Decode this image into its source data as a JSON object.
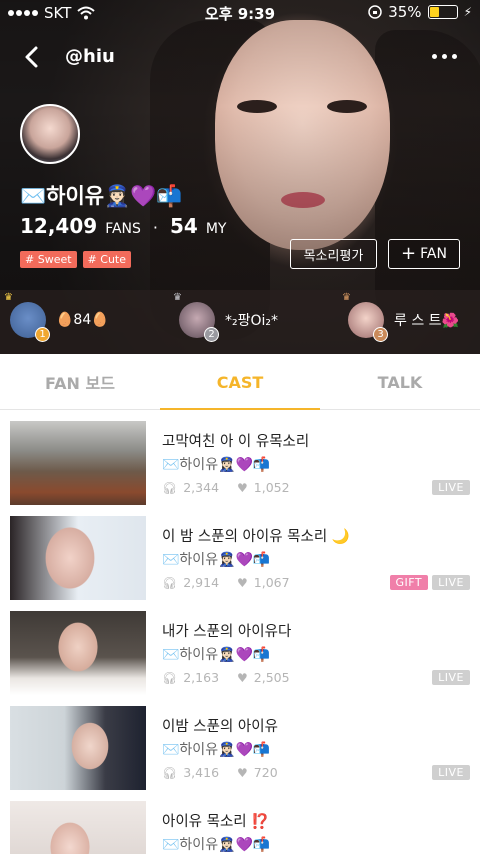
{
  "status_bar": {
    "carrier": "SKT",
    "time": "오후 9:39",
    "battery": "35%"
  },
  "profile": {
    "handle": "@hiu",
    "name": "✉️하이유👮🏻‍♀️💜📬",
    "fans_count": "12,409",
    "fans_label": "FANS",
    "separator": "·",
    "my_count": "54",
    "my_label": "MY",
    "tags": [
      "# Sweet",
      "# Cute"
    ],
    "voice_button": "목소리평가",
    "fan_button": "FAN"
  },
  "ranking": [
    {
      "rank": "1",
      "text": "🥚84🥚",
      "badge_color": "#f0a731"
    },
    {
      "rank": "2",
      "text": "*₂팡Oi₂*",
      "badge_color": "#9a9aa0"
    },
    {
      "rank": "3",
      "text": "루 스 트🌺",
      "badge_color": "#c98a5a"
    }
  ],
  "tabs": [
    {
      "label": "FAN 보드",
      "active": false
    },
    {
      "label": "CAST",
      "active": true
    },
    {
      "label": "TALK",
      "active": false
    }
  ],
  "casts": [
    {
      "title": "고막여친 아 이 유목소리",
      "author": "✉️하이유👮🏻‍♀️💜📬",
      "listens": "2,344",
      "likes": "1,052",
      "labels": [
        "LIVE"
      ]
    },
    {
      "title": "이 밤 스푼의 아이유 목소리 🌙",
      "author": "✉️하이유👮🏻‍♀️💜📬",
      "listens": "2,914",
      "likes": "1,067",
      "labels": [
        "GIFT",
        "LIVE"
      ]
    },
    {
      "title": "내가 스푼의 아이유다",
      "author": "✉️하이유👮🏻‍♀️💜📬",
      "listens": "2,163",
      "likes": "2,505",
      "labels": [
        "LIVE"
      ]
    },
    {
      "title": "이밤 스푼의 아이유",
      "author": "✉️하이유👮🏻‍♀️💜📬",
      "listens": "3,416",
      "likes": "720",
      "labels": [
        "LIVE"
      ]
    },
    {
      "title": "아이유 목소리 ⁉️",
      "author": "✉️하이유👮🏻‍♀️💜📬",
      "listens": "",
      "likes": "",
      "labels": []
    }
  ],
  "colors": {
    "accent": "#f5b52a",
    "tag": "#f26b5b",
    "live": "#cfcfcf",
    "gift": "#f07fa9"
  }
}
